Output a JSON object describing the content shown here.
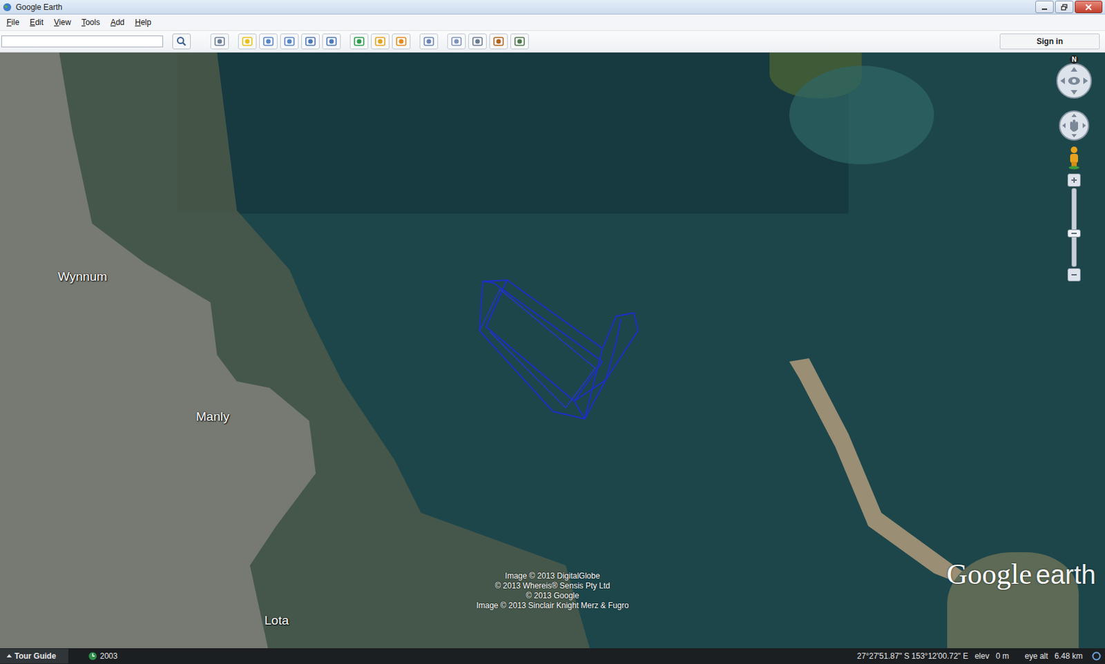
{
  "window": {
    "title": "Google Earth"
  },
  "menu": [
    "File",
    "Edit",
    "View",
    "Tools",
    "Add",
    "Help"
  ],
  "search": {
    "value": ""
  },
  "sign_in": "Sign in",
  "compass": {
    "north": "N"
  },
  "zoom": {
    "level": 0.5
  },
  "map_labels": [
    "Wynnum",
    "Manly",
    "Lota"
  ],
  "attribution": [
    "Image © 2013 DigitalGlobe",
    "© 2013 Whereis® Sensis Pty Ltd",
    "© 2013 Google",
    "Image © 2013 Sinclair Knight Merz & Fugro"
  ],
  "logo": {
    "brand": "Google",
    "product": "earth"
  },
  "status_bar": {
    "tour_guide": "Tour Guide",
    "year": "2003",
    "coordinates": "27°27'51.87\" S  153°12'00.72\" E",
    "elev_label": "elev",
    "elev_value": "0 m",
    "eye_alt_label": "eye alt",
    "eye_alt_value": "6.48 km"
  }
}
